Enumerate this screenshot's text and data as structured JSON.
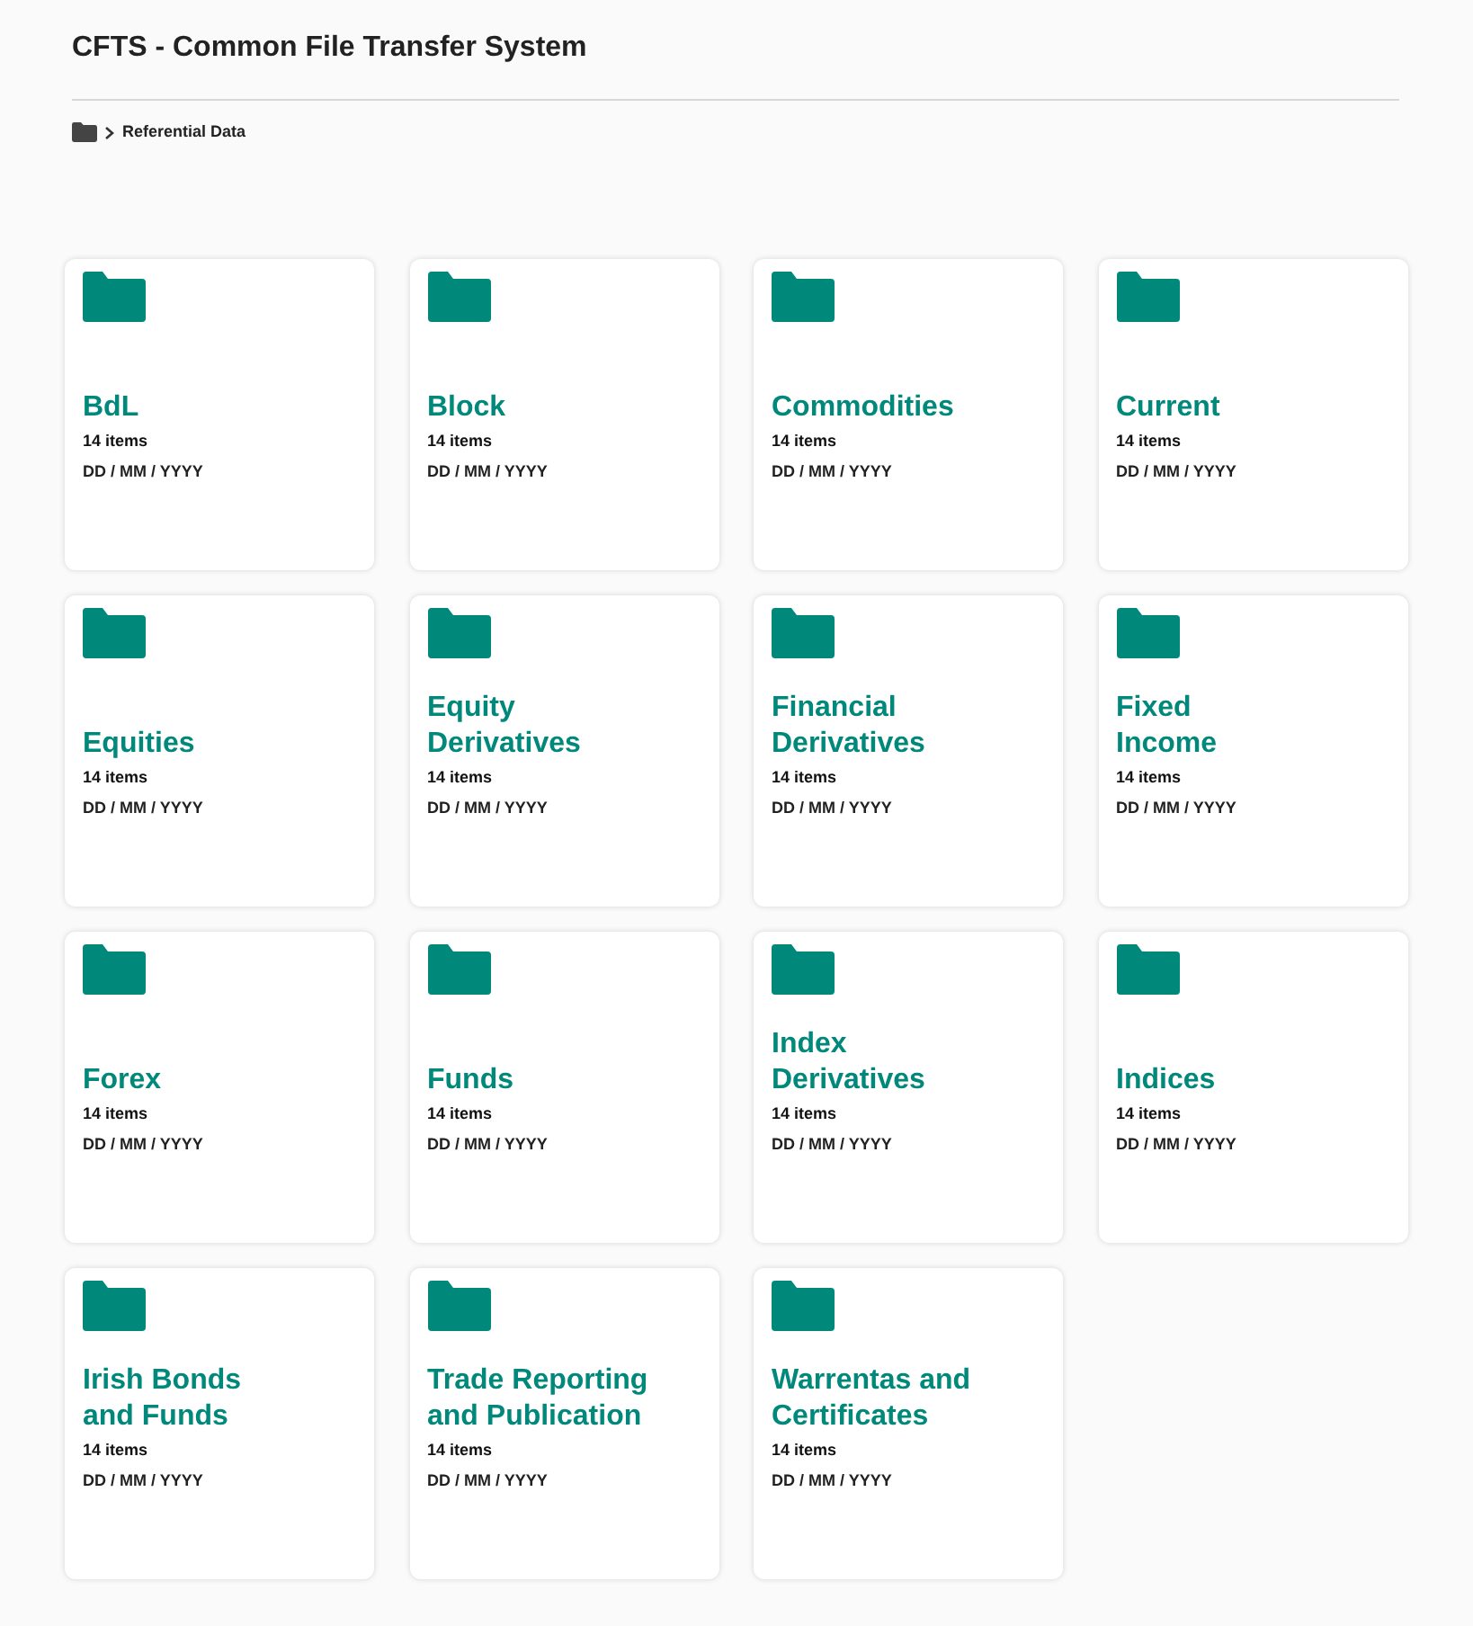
{
  "header": {
    "title": "CFTS - Common File Transfer System"
  },
  "breadcrumb": {
    "current": "Referential Data"
  },
  "folders": [
    {
      "name": "BdL",
      "count": "14 items",
      "date": "DD / MM / YYYY"
    },
    {
      "name": "Block",
      "count": "14 items",
      "date": "DD / MM / YYYY"
    },
    {
      "name": "Commodities",
      "count": "14 items",
      "date": "DD / MM / YYYY"
    },
    {
      "name": "Current",
      "count": "14 items",
      "date": "DD / MM / YYYY"
    },
    {
      "name": "Equities",
      "count": "14 items",
      "date": "DD / MM / YYYY"
    },
    {
      "name": "Equity\nDerivatives",
      "count": "14 items",
      "date": "DD / MM / YYYY"
    },
    {
      "name": "Financial\nDerivatives",
      "count": "14 items",
      "date": "DD / MM / YYYY"
    },
    {
      "name": "Fixed\nIncome",
      "count": "14 items",
      "date": "DD / MM / YYYY"
    },
    {
      "name": "Forex",
      "count": "14 items",
      "date": "DD / MM / YYYY"
    },
    {
      "name": "Funds",
      "count": "14 items",
      "date": "DD / MM / YYYY"
    },
    {
      "name": "Index\nDerivatives",
      "count": "14 items",
      "date": "DD / MM / YYYY"
    },
    {
      "name": "Indices",
      "count": "14 items",
      "date": "DD / MM / YYYY"
    },
    {
      "name": "Irish Bonds\nand Funds",
      "count": "14 items",
      "date": "DD / MM / YYYY"
    },
    {
      "name": "Trade Reporting\nand Publication",
      "count": "14 items",
      "date": "DD / MM / YYYY"
    },
    {
      "name": "Warrentas and\nCertificates",
      "count": "14 items",
      "date": "DD / MM / YYYY"
    }
  ]
}
